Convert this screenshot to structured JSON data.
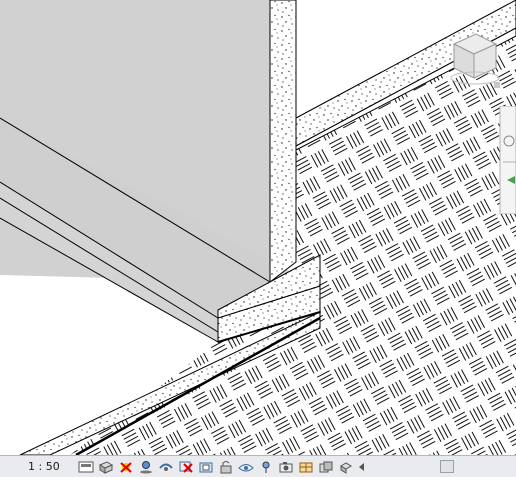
{
  "view": {
    "scale": "1 : 50"
  },
  "view_control_bar": {
    "icons": [
      "detail-level-icon",
      "visual-style-icon",
      "sun-path-icon",
      "shadows-icon",
      "show-rendering-dialog-icon",
      "crop-view-icon",
      "show-crop-region-icon",
      "unlock-3d-view-icon",
      "temporary-hide-isolate-icon",
      "reveal-hidden-elements-icon",
      "temporary-view-properties-icon",
      "hide-analytical-model-icon",
      "highlight-displacement-sets-icon",
      "reveal-constraints-icon"
    ]
  },
  "colors": {
    "status_bar_bg": "#e9ebee",
    "viewport_bg": "#ffffff",
    "shaded_surface": "#d1d1d1",
    "edge": "#000000"
  }
}
